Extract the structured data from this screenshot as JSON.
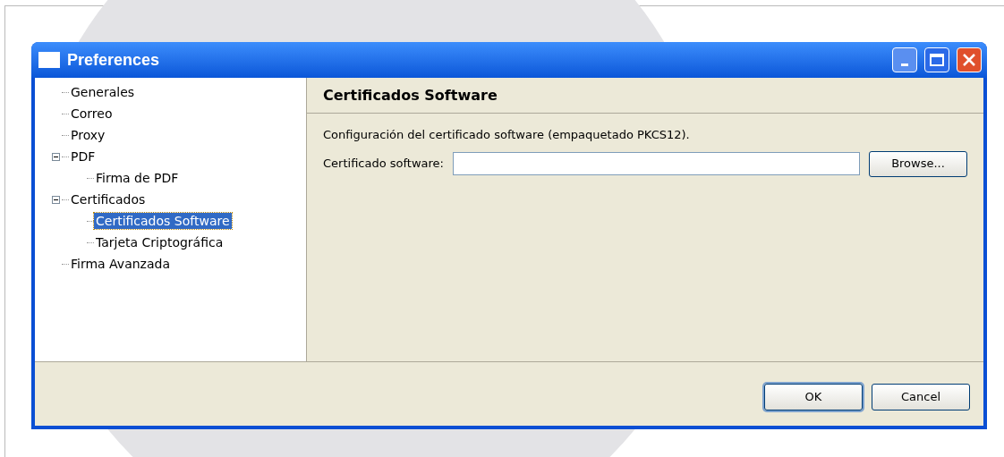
{
  "window": {
    "title": "Preferences"
  },
  "tree": [
    {
      "label": "Generales",
      "selected": false
    },
    {
      "label": "Correo",
      "selected": false
    },
    {
      "label": "Proxy",
      "selected": false
    },
    {
      "label": "PDF",
      "selected": false,
      "expanded": true,
      "children": [
        {
          "label": "Firma de PDF",
          "selected": false
        }
      ]
    },
    {
      "label": "Certificados",
      "selected": false,
      "expanded": true,
      "children": [
        {
          "label": "Certificados Software",
          "selected": true
        },
        {
          "label": "Tarjeta Criptográfica",
          "selected": false
        }
      ]
    },
    {
      "label": "Firma Avanzada",
      "selected": false
    }
  ],
  "page": {
    "title": "Certificados Software",
    "description": "Configuración del certificado software (empaquetado PKCS12).",
    "field_label": "Certificado software:",
    "browse_button": "Browse..."
  },
  "buttons": [
    "OK",
    "Cancel"
  ]
}
